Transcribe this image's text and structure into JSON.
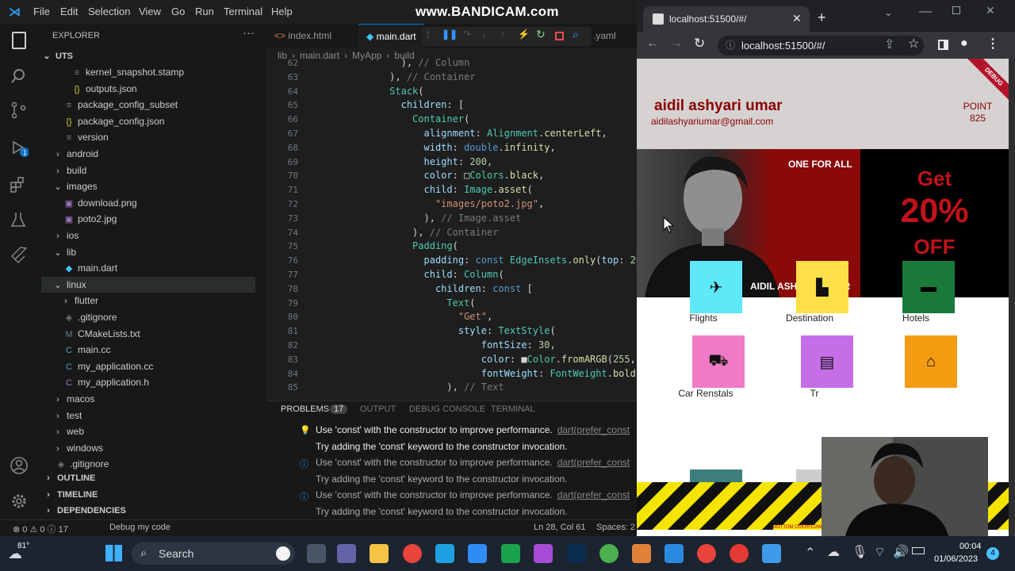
{
  "watermark": "www.BANDICAM.com",
  "vscode": {
    "menu": [
      "File",
      "Edit",
      "Selection",
      "View",
      "Go",
      "Run",
      "Terminal",
      "Help"
    ],
    "explorer_title": "EXPLORER",
    "root": "UTS",
    "tree": [
      {
        "label": "kernel_snapshot.stamp",
        "icon": "file-icon",
        "indent": 2
      },
      {
        "label": "outputs.json",
        "icon": "json-icon",
        "indent": 2
      },
      {
        "label": "package_config_subset",
        "icon": "file-icon",
        "indent": 1
      },
      {
        "label": "package_config.json",
        "icon": "json-icon",
        "indent": 1
      },
      {
        "label": "version",
        "icon": "file-icon",
        "indent": 1
      },
      {
        "label": "android",
        "icon": "chevron-right-icon",
        "indent": 0
      },
      {
        "label": "build",
        "icon": "chevron-right-icon",
        "indent": 0
      },
      {
        "label": "images",
        "icon": "chevron-down-icon",
        "indent": 0
      },
      {
        "label": "download.png",
        "icon": "image-icon",
        "indent": 1
      },
      {
        "label": "poto2.jpg",
        "icon": "image-icon",
        "indent": 1
      },
      {
        "label": "ios",
        "icon": "chevron-right-icon",
        "indent": 0
      },
      {
        "label": "lib",
        "icon": "chevron-down-icon",
        "indent": 0
      },
      {
        "label": "main.dart",
        "icon": "dart-icon",
        "indent": 1
      },
      {
        "label": "linux",
        "icon": "chevron-down-icon",
        "indent": 0
      },
      {
        "label": "flutter",
        "icon": "chevron-right-icon",
        "indent": 1
      },
      {
        "label": ".gitignore",
        "icon": "git-icon",
        "indent": 1
      },
      {
        "label": "CMakeLists.txt",
        "icon": "cmake-icon",
        "indent": 1
      },
      {
        "label": "main.cc",
        "icon": "cpp-icon",
        "indent": 1
      },
      {
        "label": "my_application.cc",
        "icon": "cpp-icon",
        "indent": 1
      },
      {
        "label": "my_application.h",
        "icon": "c-header-icon",
        "indent": 1
      },
      {
        "label": "macos",
        "icon": "chevron-right-icon",
        "indent": 0
      },
      {
        "label": "test",
        "icon": "chevron-right-icon",
        "indent": 0
      },
      {
        "label": "web",
        "icon": "chevron-right-icon",
        "indent": 0
      },
      {
        "label": "windows",
        "icon": "chevron-right-icon",
        "indent": 0
      },
      {
        "label": ".gitignore",
        "icon": "git-icon",
        "indent": 0
      }
    ],
    "sections": [
      "OUTLINE",
      "TIMELINE",
      "DEPENDENCIES"
    ],
    "tabs": [
      "index.html",
      "main.dart",
      ".yaml"
    ],
    "breadcrumb": [
      "lib",
      "main.dart",
      "MyApp",
      "build"
    ],
    "code_lines": [
      {
        "n": "62",
        "t": "                ), // Column"
      },
      {
        "n": "63",
        "t": "              ), // Container"
      },
      {
        "n": "64",
        "t": "              Stack("
      },
      {
        "n": "65",
        "t": "                children: ["
      },
      {
        "n": "66",
        "t": "                  Container("
      },
      {
        "n": "67",
        "t": "                    alignment: Alignment.centerLeft,"
      },
      {
        "n": "68",
        "t": "                    width: double.infinity,"
      },
      {
        "n": "69",
        "t": "                    height: 200,"
      },
      {
        "n": "70",
        "t": "                    color: □Colors.black,"
      },
      {
        "n": "71",
        "t": "                    child: Image.asset("
      },
      {
        "n": "72",
        "t": "                      \"images/poto2.jpg\","
      },
      {
        "n": "73",
        "t": "                    ), // Image.asset"
      },
      {
        "n": "74",
        "t": "                  ), // Container"
      },
      {
        "n": "75",
        "t": "                  Padding("
      },
      {
        "n": "76",
        "t": "                    padding: const EdgeInsets.only(top: 20"
      },
      {
        "n": "77",
        "t": "                    child: Column("
      },
      {
        "n": "78",
        "t": "                      children: const ["
      },
      {
        "n": "79",
        "t": "                        Text("
      },
      {
        "n": "80",
        "t": "                          \"Get\","
      },
      {
        "n": "81",
        "t": "                          style: TextStyle("
      },
      {
        "n": "82",
        "t": "                              fontSize: 30,"
      },
      {
        "n": "83",
        "t": "                              color: ■Color.fromARGB(255,"
      },
      {
        "n": "84",
        "t": "                              fontWeight: FontWeight.bold)"
      },
      {
        "n": "85",
        "t": "                        ), // Text"
      }
    ],
    "panel_tabs": [
      "PROBLEMS",
      "17",
      "OUTPUT",
      "DEBUG CONSOLE",
      "TERMINAL"
    ],
    "problems": [
      {
        "msg": "Use 'const' with the constructor to improve performance.",
        "src": "dart(prefer_const",
        "hint": "Try adding the 'const' keyword to the constructor invocation."
      },
      {
        "msg": "Use 'const' with the constructor to improve performance.",
        "src": "dart(prefer_const",
        "hint": "Try adding the 'const' keyword to the constructor invocation."
      },
      {
        "msg": "Use 'const' with the constructor to improve performance.",
        "src": "dart(prefer_const",
        "hint": "Try adding the 'const' keyword to the constructor invocation."
      }
    ],
    "status": {
      "left": "⊗ 0 ⚠ 0 ⓘ 17",
      "debug": "Debug my code",
      "position": "Ln 28, Col 61",
      "spaces": "Spaces: 2"
    }
  },
  "chrome": {
    "tab_title": "localhost:51500/#/",
    "url": "localhost:51500/#/",
    "app": {
      "debug_ribbon": "DEBUG",
      "name": "aidil ashyari umar",
      "email": "aidilashyariumar@gmail.com",
      "point_label": "POINT",
      "point_value": "825",
      "banner_tag": "ONE FOR ALL",
      "banner_name": "AIDIL ASHYARI UMAR",
      "promo_get": "Get",
      "promo_percent": "20%",
      "promo_off": "OFF",
      "overflow_text": "BOTTOM OVERFLOWED",
      "categories": [
        {
          "label": "Flights",
          "color": "#5ee8f8",
          "icon": "airplane-icon"
        },
        {
          "label": "Destination",
          "color": "#fde047",
          "icon": "building-icon"
        },
        {
          "label": "Hotels",
          "color": "#1a7a3a",
          "icon": "bed-icon"
        },
        {
          "label": "Car  Renstals",
          "color": "#f07ac6",
          "icon": "car-icon"
        },
        {
          "label": "Tr",
          "color": "#c46ee8",
          "icon": "train-icon"
        },
        {
          "label": "",
          "color": "#f39c12",
          "icon": "house-icon"
        }
      ],
      "colors": {
        "header_bg": "#d6d2d2",
        "name_color": "#8b0000",
        "promo_color": "#c0121a"
      }
    }
  },
  "taskbar": {
    "weather": "81°",
    "search_label": "Search",
    "time": "00:04",
    "date": "01/06/2023",
    "notif_count": "4"
  }
}
